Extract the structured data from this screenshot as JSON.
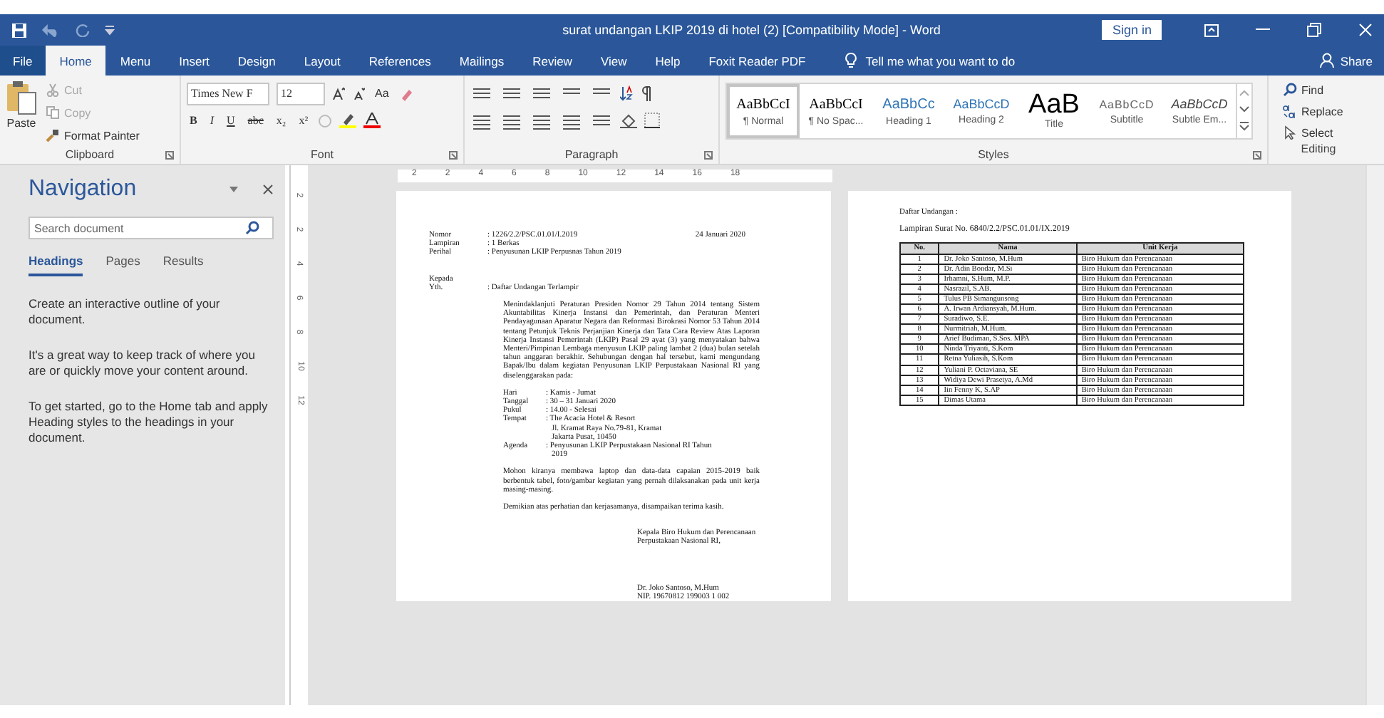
{
  "window": {
    "title": "surat undangan LKIP 2019 di hotel (2) [Compatibility Mode] - Word",
    "sign_in": "Sign in"
  },
  "tabs": [
    {
      "label": "File",
      "selected": false,
      "kind": "file"
    },
    {
      "label": "Home",
      "selected": true,
      "kind": "tab"
    },
    {
      "label": "Menu",
      "selected": false,
      "kind": "tab"
    },
    {
      "label": "Insert",
      "selected": false,
      "kind": "tab"
    },
    {
      "label": "Design",
      "selected": false,
      "kind": "tab"
    },
    {
      "label": "Layout",
      "selected": false,
      "kind": "tab"
    },
    {
      "label": "References",
      "selected": false,
      "kind": "tab"
    },
    {
      "label": "Mailings",
      "selected": false,
      "kind": "tab"
    },
    {
      "label": "Review",
      "selected": false,
      "kind": "tab"
    },
    {
      "label": "View",
      "selected": false,
      "kind": "tab"
    },
    {
      "label": "Help",
      "selected": false,
      "kind": "tab"
    },
    {
      "label": "Foxit Reader PDF",
      "selected": false,
      "kind": "tab"
    }
  ],
  "tell_me": "Tell me what you want to do",
  "share": "Share",
  "clipboard": {
    "label": "Clipboard",
    "paste": "Paste",
    "items": [
      {
        "label": "Cut",
        "disabled": true,
        "kind": "cut"
      },
      {
        "label": "Copy",
        "disabled": true,
        "kind": "copy"
      },
      {
        "label": "Format Painter",
        "disabled": false,
        "kind": "painter"
      }
    ]
  },
  "font": {
    "label": "Font",
    "name": "Times New F",
    "size": "12",
    "case": "Aa",
    "formats": [
      "B",
      "I",
      "U",
      "abc",
      "x₂",
      "x²"
    ]
  },
  "paragraph": {
    "label": "Paragraph"
  },
  "styles": {
    "label": "Styles",
    "items": [
      {
        "sample": "AaBbCcI",
        "name": "¶ Normal",
        "selected": true,
        "kind": "serif"
      },
      {
        "sample": "AaBbCcI",
        "name": "¶ No Spac...",
        "selected": false,
        "kind": "serif"
      },
      {
        "sample": "AaBbCс",
        "name": "Heading 1",
        "selected": false,
        "kind": "heading1"
      },
      {
        "sample": "AaBbCcD",
        "name": "Heading 2",
        "selected": false,
        "kind": "heading2"
      },
      {
        "sample": "AaB",
        "name": "Title",
        "selected": false,
        "kind": "title"
      },
      {
        "sample": "AaBbCcD",
        "name": "Subtitle",
        "selected": false,
        "kind": "subtitle"
      },
      {
        "sample": "AaBbCcD",
        "name": "Subtle Em...",
        "selected": false,
        "kind": "emphasis"
      }
    ]
  },
  "editing": {
    "label": "Editing",
    "items": [
      {
        "label": "Find",
        "kind": "find"
      },
      {
        "label": "Replace",
        "kind": "replace"
      },
      {
        "label": "Select",
        "kind": "select"
      }
    ]
  },
  "ruler": {
    "marks": [
      "2",
      "2",
      "4",
      "6",
      "8",
      "10",
      "12",
      "14",
      "16",
      "18"
    ],
    "vertical_marks": [
      "2",
      "2",
      "4",
      "6",
      "8",
      "10",
      "12"
    ]
  },
  "navigation": {
    "title": "Navigation",
    "placeholder": "Search document",
    "tabs": [
      {
        "label": "Headings",
        "selected": true
      },
      {
        "label": "Pages",
        "selected": false
      },
      {
        "label": "Results",
        "selected": false
      }
    ],
    "paragraphs": [
      "Create an interactive outline of your document.",
      "It's a great way to keep track of where you are or quickly move your content around.",
      "To get started, go to the Home tab and apply Heading styles to the headings in your document."
    ]
  },
  "letter": {
    "date": "24 Januari 2020",
    "header": [
      {
        "label": "Nomor",
        "value": ": 1226/2.2/PSC.01.01/I.2019"
      },
      {
        "label": "Lampiran",
        "value": ": 1 Berkas"
      },
      {
        "label": "Perihal",
        "value": ": Penyusunan LKIP Perpusnas Tahun 2019"
      }
    ],
    "to_label": "Kepada",
    "to_label_2": "Yth.",
    "to_value": ": Daftar Undangan Terlampir",
    "body": "Menindaklanjuti Peraturan Presiden Nomor 29 Tahun 2014 tentang Sistem Akuntabilitas Kinerja Instansi dan Pemerintah, dan Peraturan Menteri Pendayagunaan Aparatur Negara dan Reformasi Birokrasi Nomor 53 Tahun 2014 tentang Petunjuk Teknis Perjanjian Kinerja dan Tata Cara Review Atas Laporan Kinerja Instansi Pemerintah (LKIP) Pasal 29 ayat (3) yang menyatakan bahwa Menteri/Pimpinan Lembaga menyusun LKIP paling lambat 2 (dua) bulan setelah tahun anggaran berakhir. Sehubungan dengan hal tersebut, kami mengundang Bapak/Ibu dalam kegiatan Penyusunan LKIP Perpustakaan Nasional RI yang diselenggarakan pada:",
    "details": [
      {
        "label": "Hari",
        "lines": [
          ": Kamis - Jumat"
        ]
      },
      {
        "label": "Tanggal",
        "lines": [
          ": 30 – 31 Januari 2020"
        ]
      },
      {
        "label": "Pukul",
        "lines": [
          ": 14.00 - Selesai"
        ]
      },
      {
        "label": "Tempat",
        "lines": [
          ": The Acacia Hotel & Resort",
          "Jl. Kramat Raya No.79-81, Kramat",
          "Jakarta Pusat, 10450"
        ]
      },
      {
        "label": "Agenda",
        "lines": [
          ": Penyusunan LKIP Perpustakaan Nasional RI Tahun",
          "2019"
        ]
      }
    ],
    "closing": [
      "Mohon kiranya membawa laptop dan data-data capaian 2015-2019 baik berbentuk tabel, foto/gambar kegiatan yang pernah dilaksanakan pada unit kerja masing-masing.",
      "Demikian atas perhatian dan kerjasamanya, disampaikan terima kasih."
    ],
    "signature": [
      "Kepala Biro Hukum dan Perencanaan",
      "Perpustakaan Nasional RI,"
    ],
    "signer": [
      "Dr. Joko Santoso, M.Hum",
      "NIP. 19670812 199003 1 002"
    ]
  },
  "attachment": {
    "intro": "Daftar Undangan :",
    "title": "Lampiran Surat No. 6840/2.2/PSC.01.01/IX.2019",
    "table": {
      "columns": [
        "No.",
        "Nama",
        "Unit Kerja"
      ],
      "rows": [
        [
          "1",
          "Dr. Joko Santoso, M.Hum",
          "Biro Hukum dan Perencanaan"
        ],
        [
          "2",
          "Dr. Adin Bondar, M.Si",
          "Biro Hukum dan Perencanaan"
        ],
        [
          "3",
          "Irhamni, S.Hum, M.P.",
          "Biro Hukum dan Perencanaan"
        ],
        [
          "4",
          "Nasrazil, S.AB.",
          "Biro Hukum dan Perencanaan"
        ],
        [
          "5",
          "Tulus PB Simangunsong",
          "Biro Hukum dan Perencanaan"
        ],
        [
          "6",
          "A. Irwan Ardiansyah, M.Hum.",
          "Biro Hukum dan Perencanaan"
        ],
        [
          "7",
          "Suradiwo, S.E.",
          "Biro Hukum dan Perencanaan"
        ],
        [
          "8",
          "Nurmitriah, M.Hum.",
          "Biro Hukum dan Perencanaan"
        ],
        [
          "9",
          "Arief Budiman, S.Sos. MPA",
          "Biro Hukum dan Perencanaan"
        ],
        [
          "10",
          "Ninda Triyanti, S.Kom",
          "Biro Hukum dan Perencanaan"
        ],
        [
          "11",
          "Retna Yuliasih, S.Kom",
          "Biro Hukum dan Perencanaan"
        ],
        [
          "12",
          "Yuliani P. Octaviana, SE",
          "Biro Hukum dan Perencanaan"
        ],
        [
          "13",
          "Widiya Dewi Prasetya, A.Md",
          "Biro Hukum dan Perencanaan"
        ],
        [
          "14",
          "Iin Fenny K, S.AP",
          "Biro Hukum dan Perencanaan"
        ],
        [
          "15",
          "Dimas Utama",
          "Biro Hukum dan Perencanaan"
        ]
      ]
    }
  }
}
